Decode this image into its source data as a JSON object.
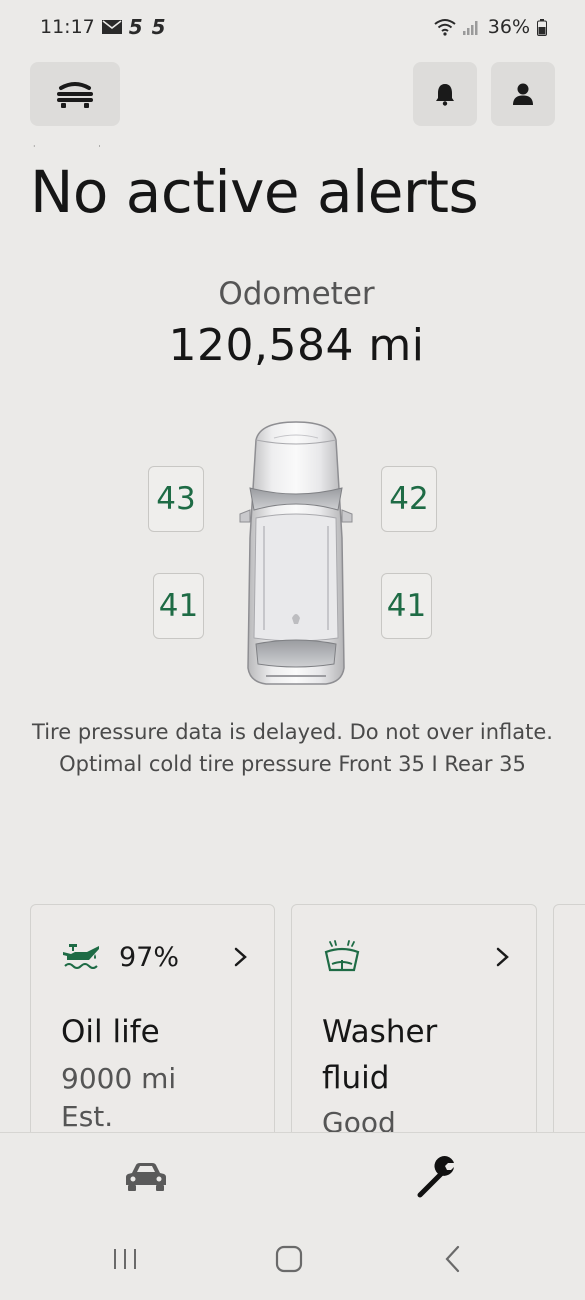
{
  "status_bar": {
    "time": "11:17",
    "notif_text": "5 5",
    "battery": "36%"
  },
  "top_actions": {
    "menu_icon": "vehicle-menu-icon",
    "bell_icon": "bell-icon",
    "account_icon": "account-icon"
  },
  "header": {
    "title": "No active alerts"
  },
  "odometer": {
    "label": "Odometer",
    "value": "120,584 mi"
  },
  "tires": {
    "front_left": "43",
    "front_right": "42",
    "rear_left": "41",
    "rear_right": "41",
    "note_line1": "Tire pressure data is delayed. Do not over inflate.",
    "note_line2": "Optimal cold tire pressure Front 35 I Rear 35"
  },
  "cards": [
    {
      "icon": "oil-can-icon",
      "percent": "97%",
      "title": "Oil life",
      "sub1": "9000 mi",
      "sub2": "Est."
    },
    {
      "icon": "windshield-washer-icon",
      "title_line1": "Washer",
      "title_line2": "fluid",
      "status": "Good"
    }
  ],
  "bottom_nav": {
    "vehicle_icon": "car-icon",
    "service_icon": "wrench-icon"
  },
  "colors": {
    "accent_green": "#1e6b45",
    "background": "#ebeae8"
  }
}
